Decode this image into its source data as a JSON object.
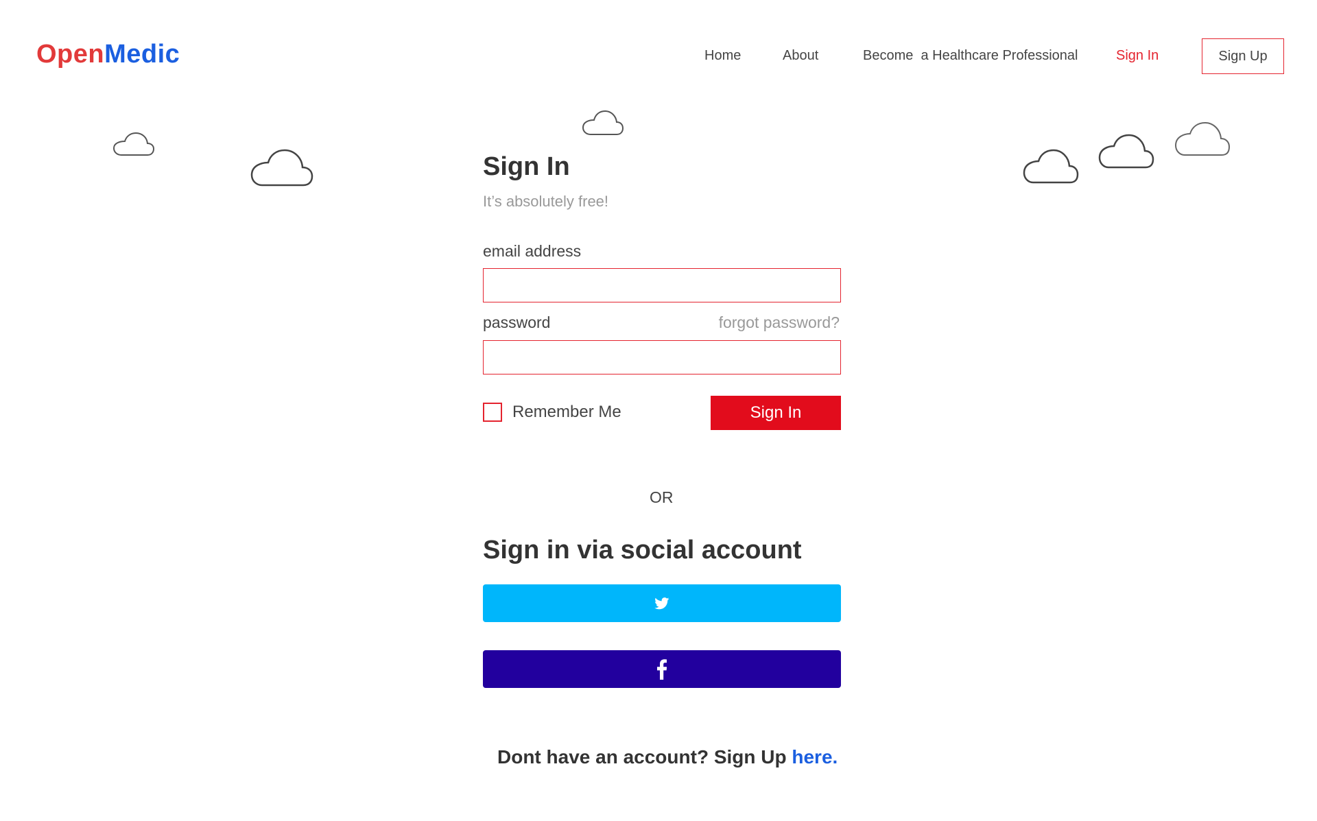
{
  "logo": {
    "part1": "Open",
    "part2": "Medic"
  },
  "nav": {
    "home": "Home",
    "about": "About",
    "become": "Become  a Healthcare Professional",
    "signin": "Sign In",
    "signup": "Sign Up"
  },
  "form": {
    "title": "Sign In",
    "subtitle": "It’s absolutely free!",
    "email_label": "email address",
    "email_value": "",
    "password_label": "password",
    "password_value": "",
    "forgot": "forgot password?",
    "remember": "Remember Me",
    "remember_checked": false,
    "submit": "Sign In"
  },
  "divider": "OR",
  "social": {
    "title": "Sign in via social account",
    "twitter_icon": "twitter-icon",
    "facebook_icon": "facebook-icon"
  },
  "footer": {
    "text": "Dont have an account? Sign Up ",
    "link": "here."
  },
  "colors": {
    "accent_red": "#e4232e",
    "brand_blue": "#1b5fe0",
    "twitter": "#00b6fb",
    "facebook": "#22009e"
  }
}
